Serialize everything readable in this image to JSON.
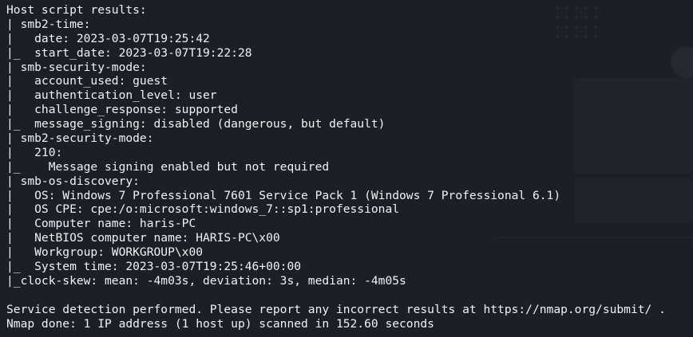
{
  "terminal": {
    "lines": [
      "Host script results:",
      "| smb2-time:",
      "|   date: 2023-03-07T19:25:42",
      "|_  start_date: 2023-03-07T19:22:28",
      "| smb-security-mode:",
      "|   account_used: guest",
      "|   authentication_level: user",
      "|   challenge_response: supported",
      "|_  message_signing: disabled (dangerous, but default)",
      "| smb2-security-mode:",
      "|   210:",
      "|_    Message signing enabled but not required",
      "| smb-os-discovery:",
      "|   OS: Windows 7 Professional 7601 Service Pack 1 (Windows 7 Professional 6.1)",
      "|   OS CPE: cpe:/o:microsoft:windows_7::sp1:professional",
      "|   Computer name: haris-PC",
      "|   NetBIOS computer name: HARIS-PC\\x00",
      "|   Workgroup: WORKGROUP\\x00",
      "|_  System time: 2023-03-07T19:25:46+00:00",
      "|_clock-skew: mean: -4m03s, deviation: 3s, median: -4m05s",
      "",
      "Service detection performed. Please report any incorrect results at https://nmap.org/submit/ .",
      "Nmap done: 1 IP address (1 host up) scanned in 152.60 seconds"
    ]
  }
}
